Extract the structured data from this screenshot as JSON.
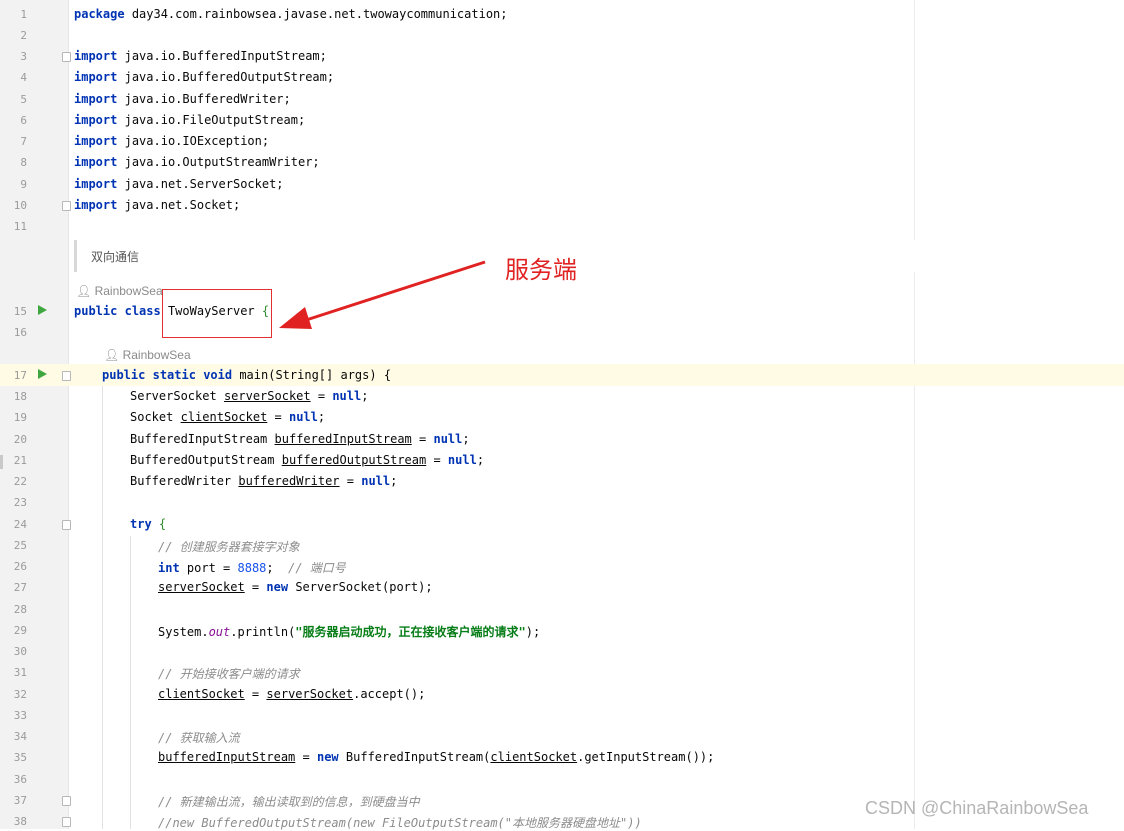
{
  "editor": {
    "package_line": "day34.com.rainbowsea.javase.net.twowaycommunication;",
    "imports": [
      "java.io.BufferedInputStream;",
      "java.io.BufferedOutputStream;",
      "java.io.BufferedWriter;",
      "java.io.FileOutputStream;",
      "java.io.IOException;",
      "java.io.OutputStreamWriter;",
      "java.net.ServerSocket;",
      "java.net.Socket;"
    ],
    "doc_comment": "双向通信",
    "author_class": "RainbowSea",
    "author_method": "RainbowSea",
    "class_name": "TwoWayServer",
    "line_numbers": [
      "1",
      "2",
      "3",
      "4",
      "5",
      "6",
      "7",
      "8",
      "9",
      "10",
      "11",
      "15",
      "16",
      "17",
      "18",
      "19",
      "20",
      "21",
      "22",
      "23",
      "24",
      "25",
      "26",
      "27",
      "28",
      "29",
      "30",
      "31",
      "32",
      "33",
      "34",
      "35",
      "36",
      "37",
      "38"
    ]
  },
  "code": {
    "kw_package": "package",
    "kw_import": "import",
    "kw_public": "public",
    "kw_class": "class",
    "kw_static": "static",
    "kw_void": "void",
    "kw_null": "null",
    "kw_try": "try",
    "kw_int": "int",
    "kw_new": "new",
    "main_sig": "main(String[] args) {",
    "t_serversocket": "ServerSocket",
    "v_serversocket": "serverSocket",
    "t_socket": "Socket",
    "v_clientsocket": "clientSocket",
    "t_bis": "BufferedInputStream",
    "v_bis": "bufferedInputStream",
    "t_bos": "BufferedOutputStream",
    "v_bos": "bufferedOutputStream",
    "t_bw": "BufferedWriter",
    "v_bw": "bufferedWriter",
    "cm_create": "// 创建服务器套接字对象",
    "port_decl": "port = ",
    "port_value": "8888",
    "cm_port": "// 端口号",
    "ss_new_tail": "ServerSocket(port);",
    "println_pre": "System.",
    "println_out": "out",
    "println_mid": ".println(",
    "println_str": "\"服务器启动成功，正在接收客户端的请求\"",
    "cm_accept": "// 开始接收客户端的请求",
    "accept_tail": ".accept();",
    "cm_input": "// 获取输入流",
    "bis_new_tail": "BufferedInputStream(",
    "get_input": ".getInputStream());",
    "cm_output": "// 新建输出流，输出读取到的信息，到硬盘当中",
    "cm_fos": "//new BufferedOutputStream(new FileOutputStream(\"本地服务器硬盘地址\"))"
  },
  "annotation": {
    "label": "服务端",
    "color": "#e02222"
  },
  "watermark": "CSDN @ChinaRainbowSea"
}
